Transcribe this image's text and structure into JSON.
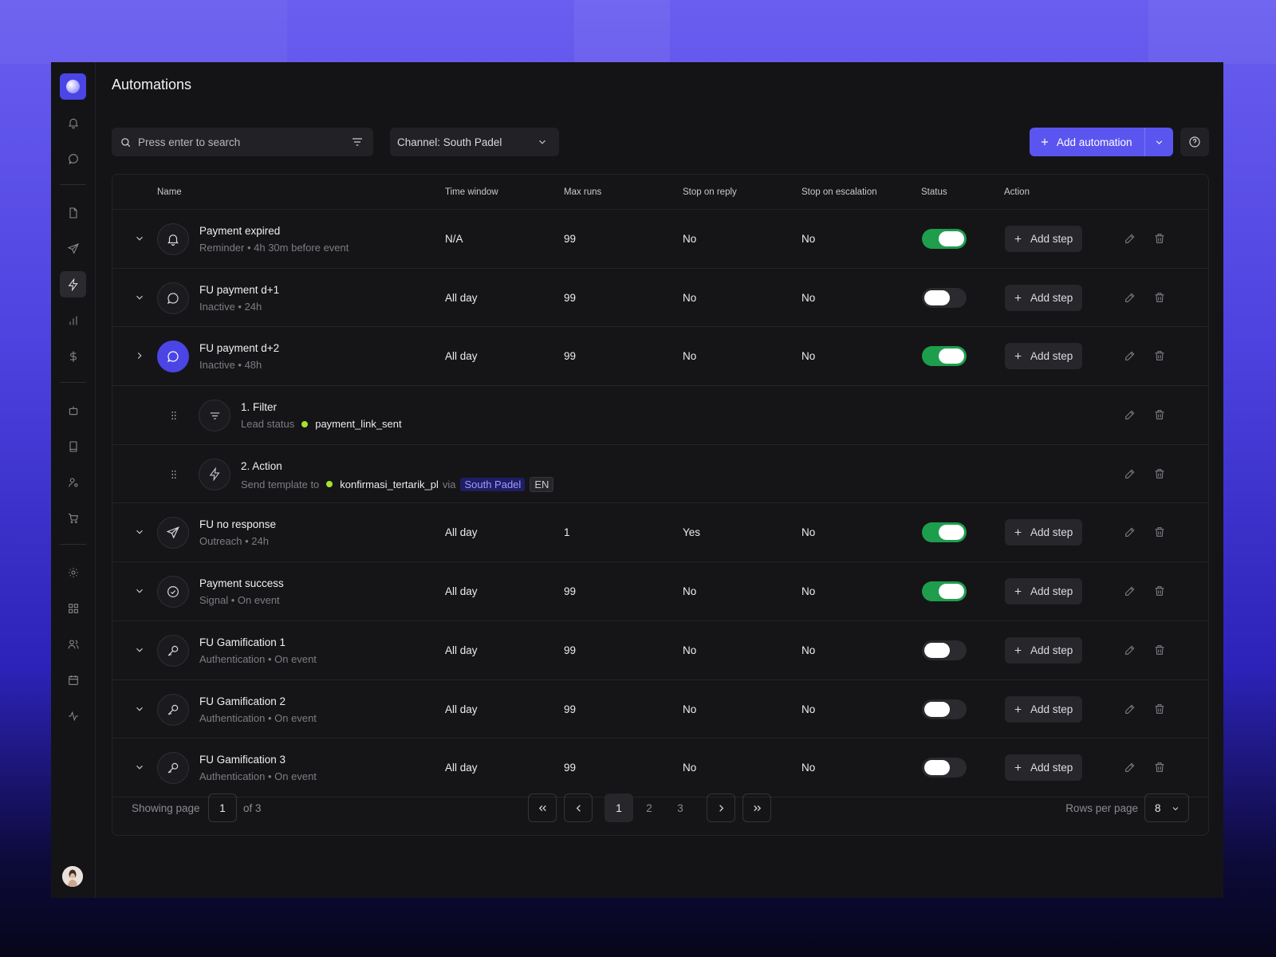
{
  "page": {
    "title": "Automations"
  },
  "toolbar": {
    "search_placeholder": "Press enter to search",
    "channel_label": "Channel: South Padel",
    "add_automation_label": "Add automation"
  },
  "columns": [
    "Name",
    "Time window",
    "Max runs",
    "Stop on reply",
    "Stop on escalation",
    "Status",
    "Action"
  ],
  "rows": [
    {
      "name": "Payment expired",
      "meta": "Reminder • 4h 30m before event",
      "icon": "bell-icon",
      "time_window": "N/A",
      "max_runs": "99",
      "stop_on_reply": "No",
      "stop_on_escalation": "No",
      "status_on": true,
      "expanded": false
    },
    {
      "name": "FU payment d+1",
      "meta": "Inactive • 24h",
      "icon": "chat-bubble-icon",
      "time_window": "All day",
      "max_runs": "99",
      "stop_on_reply": "No",
      "stop_on_escalation": "No",
      "status_on": false,
      "expanded": false
    },
    {
      "name": "FU payment d+2",
      "meta": "Inactive • 48h",
      "icon": "chat-bubble-icon",
      "time_window": "All day",
      "max_runs": "99",
      "stop_on_reply": "No",
      "stop_on_escalation": "No",
      "status_on": true,
      "expanded": true
    },
    {
      "name": "FU no response",
      "meta": "Outreach • 24h",
      "icon": "send-icon",
      "time_window": "All day",
      "max_runs": "1",
      "stop_on_reply": "Yes",
      "stop_on_escalation": "No",
      "status_on": true,
      "expanded": false
    },
    {
      "name": "Payment success",
      "meta": "Signal • On event",
      "icon": "check-circle-icon",
      "time_window": "All day",
      "max_runs": "99",
      "stop_on_reply": "No",
      "stop_on_escalation": "No",
      "status_on": true,
      "expanded": false
    },
    {
      "name": "FU Gamification 1",
      "meta": "Authentication • On event",
      "icon": "key-icon",
      "time_window": "All day",
      "max_runs": "99",
      "stop_on_reply": "No",
      "stop_on_escalation": "No",
      "status_on": false,
      "expanded": false
    },
    {
      "name": "FU Gamification 2",
      "meta": "Authentication • On event",
      "icon": "key-icon",
      "time_window": "All day",
      "max_runs": "99",
      "stop_on_reply": "No",
      "stop_on_escalation": "No",
      "status_on": false,
      "expanded": false
    },
    {
      "name": "FU Gamification 3",
      "meta": "Authentication • On event",
      "icon": "key-icon",
      "time_window": "All day",
      "max_runs": "99",
      "stop_on_reply": "No",
      "stop_on_escalation": "No",
      "status_on": false,
      "expanded": false
    }
  ],
  "add_step_label": "Add step",
  "steps": [
    {
      "title": "1. Filter",
      "label": "Lead status",
      "value": "payment_link_sent",
      "icon": "filter-icon"
    },
    {
      "title": "2. Action",
      "label": "Send template to",
      "value": "konfirmasi_tertarik_pl",
      "via": "via",
      "channel": "South Padel",
      "lang": "EN",
      "icon": "lightning-icon"
    }
  ],
  "pagination": {
    "showing_label": "Showing page",
    "current": "1",
    "of_label": "of 3",
    "pages": [
      "1",
      "2",
      "3"
    ],
    "rows_per_page_label": "Rows per page",
    "rows_per_page": "8"
  },
  "colors": {
    "accent": "#5b55f0",
    "toggle_on": "#1e9e4c",
    "status_dot": "#a6e22e"
  }
}
